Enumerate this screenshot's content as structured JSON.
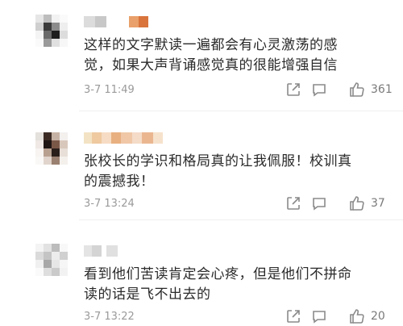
{
  "comments": [
    {
      "text": "这样的文字默读一遍都会有心灵激荡的感觉，如果大声背诵感觉真的很能增强自信",
      "time": "3-7 11:49",
      "likes": "361"
    },
    {
      "text": "张校长的学识和格局真的让我佩服！校训真的震撼我！",
      "time": "3-7 13:24",
      "likes": "37"
    },
    {
      "text": "看到他们苦读肯定会心疼，但是他们不拼命读的话是飞不出去的",
      "time": "3-7 13:22",
      "likes": "20"
    }
  ]
}
